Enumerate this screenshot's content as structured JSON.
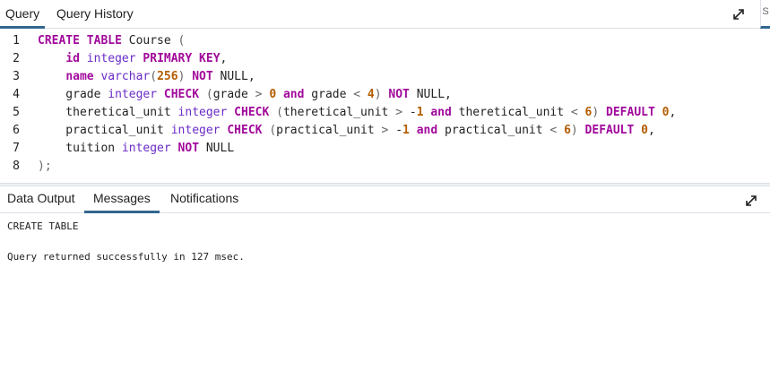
{
  "tabs": {
    "query": "Query",
    "history": "Query History",
    "side": "S"
  },
  "editor": {
    "line_numbers": [
      "1",
      "2",
      "3",
      "4",
      "5",
      "6",
      "7",
      "8"
    ]
  },
  "results": {
    "tabs": {
      "data_output": "Data Output",
      "messages": "Messages",
      "notifications": "Notifications"
    },
    "messages": {
      "line1": "CREATE TABLE",
      "line2": "",
      "line3": "Query returned successfully in 127 msec."
    }
  },
  "colors": {
    "active_tab_underline": "#326690",
    "keyword": "#a10a9b",
    "type": "#6b2cc7",
    "number": "#b35c00"
  },
  "icons": {
    "expand": "expand-diagonal-icon"
  }
}
